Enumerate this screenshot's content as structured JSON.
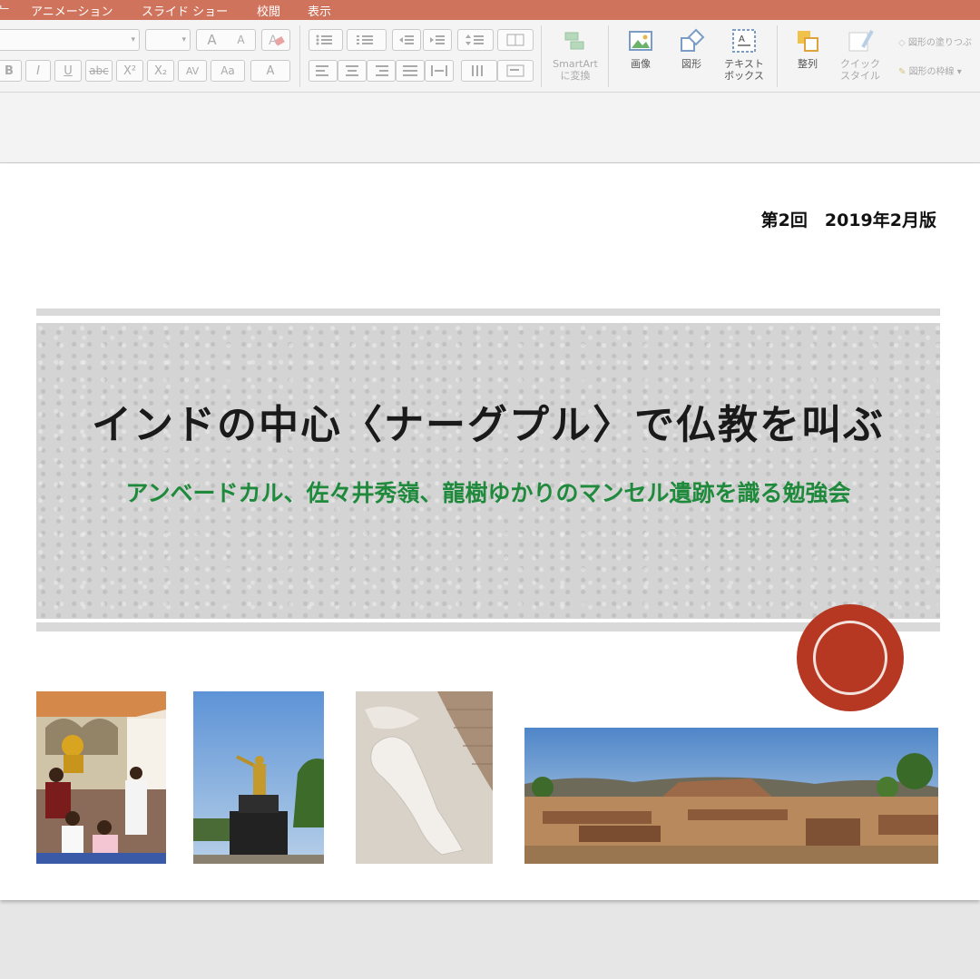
{
  "menu": {
    "tabs": [
      "アニメーション",
      "スライド ショー",
      "校閲",
      "表示"
    ]
  },
  "ribbon": {
    "font_size_up": "A",
    "font_size_down": "A",
    "bold": "B",
    "italic": "I",
    "underline": "U",
    "strikethrough": "abc",
    "superscript": "X²",
    "subscript": "X₂",
    "char_spacing": "AV",
    "change_case": "Aa",
    "font_color": "A",
    "smartart_line1": "SmartArt",
    "smartart_line2": "に変換",
    "picture": "画像",
    "shape": "図形",
    "textbox_line1": "テキスト",
    "textbox_line2": "ボックス",
    "arrange": "整列",
    "quick_styles_line1": "クイック",
    "quick_styles_line2": "スタイル",
    "shape_fill": "図形の塗りつぶ",
    "shape_outline": "図形の枠線"
  },
  "slide": {
    "edition": "第2回　2019年2月版",
    "title": "インドの中心〈ナーグプル〉で仏教を叫ぶ",
    "subtitle": "アンベードカル、佐々井秀嶺、龍樹ゆかりのマンセル遺跡を識る勉強会",
    "colors": {
      "title": "#1a1a1a",
      "subtitle": "#1f8a3c",
      "stamp": "#b63722",
      "tabbar": "#d0735c"
    }
  }
}
